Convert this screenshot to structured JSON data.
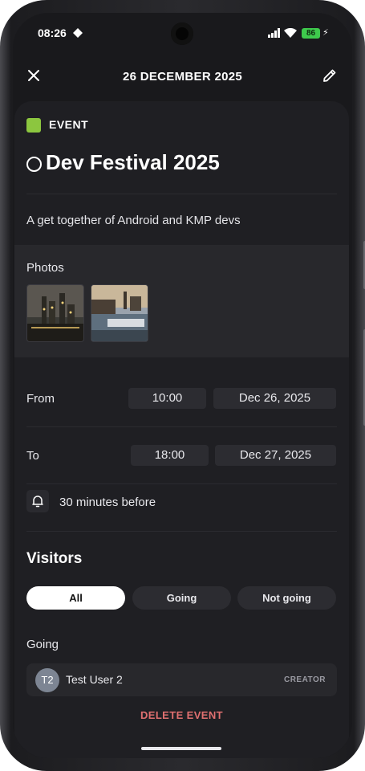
{
  "status_bar": {
    "time": "08:26",
    "battery": "86"
  },
  "header": {
    "title": "26 DECEMBER 2025"
  },
  "event": {
    "category": {
      "label": "EVENT",
      "color": "#8cc63f"
    },
    "title": "Dev Festival 2025",
    "description": "A get together of Android and KMP devs"
  },
  "photos": {
    "label": "Photos",
    "count": 2
  },
  "schedule": {
    "from": {
      "label": "From",
      "time": "10:00",
      "date": "Dec 26, 2025"
    },
    "to": {
      "label": "To",
      "time": "18:00",
      "date": "Dec 27, 2025"
    }
  },
  "reminder": {
    "text": "30 minutes before"
  },
  "visitors": {
    "title": "Visitors",
    "filters": [
      "All",
      "Going",
      "Not going"
    ],
    "selected_filter": "All",
    "going_label": "Going",
    "list": [
      {
        "initials": "T2",
        "name": "Test User 2",
        "role": "CREATOR"
      }
    ]
  },
  "actions": {
    "delete": "DELETE EVENT"
  }
}
